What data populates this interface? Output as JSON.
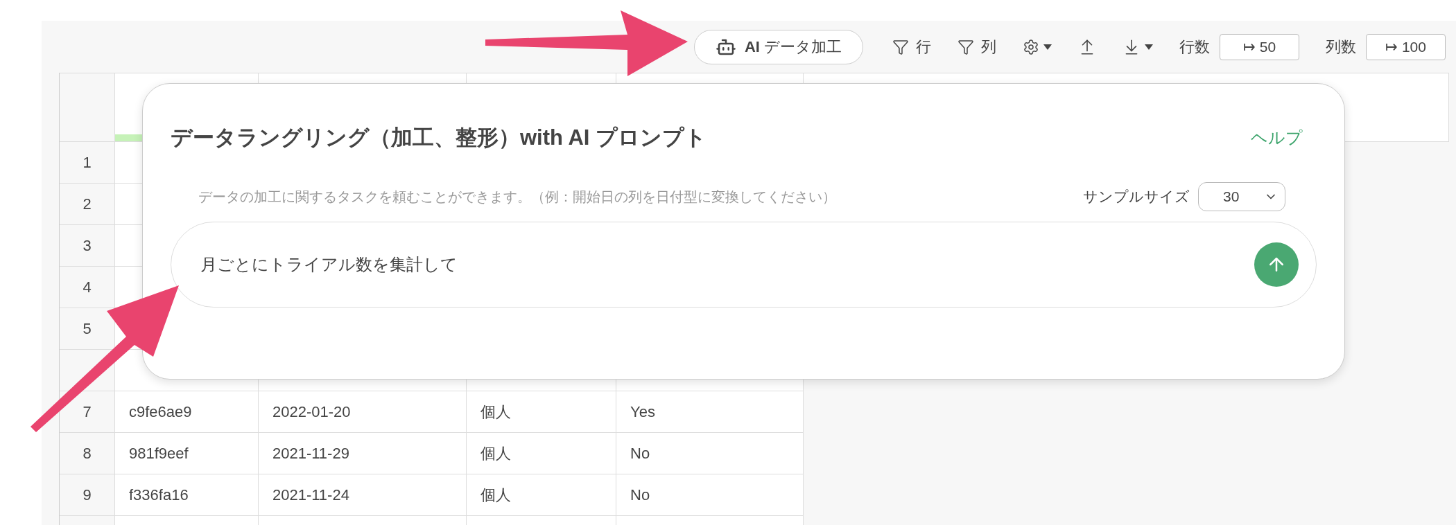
{
  "toolbar": {
    "ai_button": {
      "label": "**AI** データ加工"
    },
    "filters": [
      {
        "label": "行"
      },
      {
        "label": "列"
      }
    ],
    "counts": [
      {
        "label": "行数",
        "value": "↦ 50"
      },
      {
        "label": "列数",
        "value": "↦ 100"
      }
    ]
  },
  "table": {
    "rows": [
      {
        "number": "1"
      },
      {
        "number": "2"
      },
      {
        "number": "3"
      },
      {
        "number": "4"
      },
      {
        "number": "5"
      },
      {},
      {
        "number": "7",
        "cells": [
          "c9fe6ae9",
          "2022-01-20",
          "個人",
          "Yes"
        ]
      },
      {
        "number": "8",
        "cells": [
          "981f9eef",
          "2021-11-29",
          "個人",
          "No"
        ]
      },
      {
        "number": "9",
        "cells": [
          "f336fa16",
          "2021-11-24",
          "個人",
          "No"
        ]
      }
    ]
  },
  "dialog": {
    "title": "データラングリング（加工、整形）with AI プロンプト",
    "help_link": "ヘルプ",
    "hint": "データの加工に関するタスクを頼むことができます。（例：開始日の列を日付型に変換してください）",
    "sample_size": {
      "label": "サンプルサイズ",
      "value": "30"
    },
    "prompt": {
      "value": "月ごとにトライアル数を集計して"
    }
  }
}
